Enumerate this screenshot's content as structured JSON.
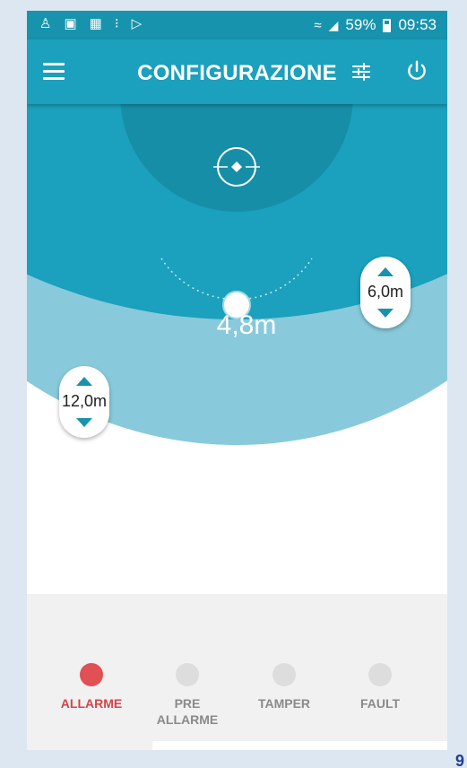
{
  "status_bar": {
    "battery_percent": "59%",
    "time": "09:53",
    "icons": [
      "notification-icon",
      "image-icon",
      "gallery-icon",
      "sync-icon",
      "play-store-icon",
      "wifi-icon",
      "signal-icon",
      "battery-icon"
    ]
  },
  "app_bar": {
    "title": "CONFIGURAZIONE",
    "icons": [
      "hamburger-menu-icon",
      "tune-icon",
      "power-icon"
    ]
  },
  "radar": {
    "current_distance": "4,8m",
    "inner_zone_value": "6,0m",
    "outer_zone_value": "12,0m",
    "colors": {
      "outer_ring": "#88cadb",
      "middle_ring": "#1ba0bd",
      "inner_zone": "#178ea7"
    }
  },
  "indicators": [
    {
      "label_line1": "ALLARME",
      "label_line2": "",
      "active": true
    },
    {
      "label_line1": "PRE",
      "label_line2": "ALLARME",
      "active": false
    },
    {
      "label_line1": "TAMPER",
      "label_line2": "",
      "active": false
    },
    {
      "label_line1": "FAULT",
      "label_line2": "",
      "active": false
    }
  ],
  "colors": {
    "primary": "#1ba0bd",
    "status_bar": "#1893ad",
    "alarm_active": "#e05055",
    "indicator_inactive": "#dddddd"
  }
}
